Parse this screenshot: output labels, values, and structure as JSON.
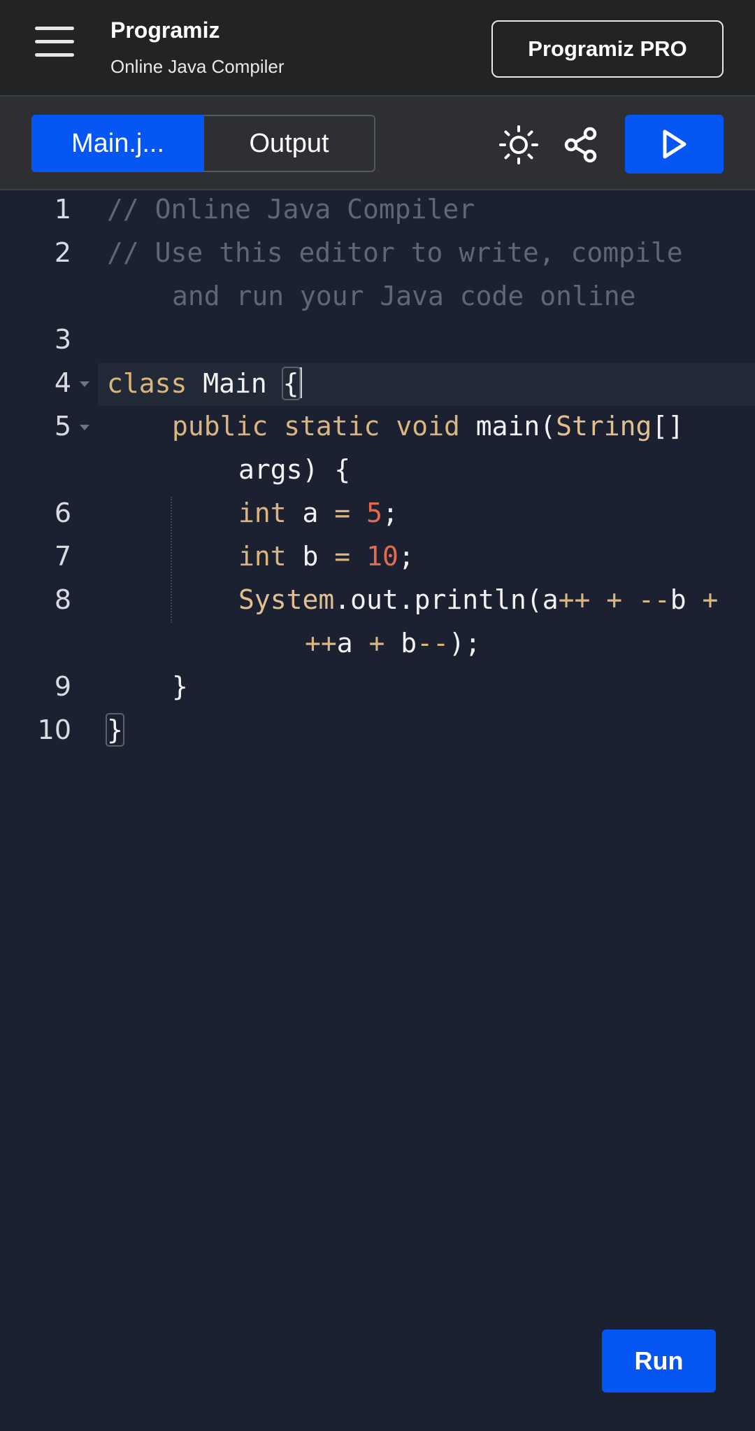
{
  "header": {
    "brand": "rogramiz",
    "brand_initial": "P",
    "subtitle": "Online Java Compiler",
    "pro_button": "Programiz PRO"
  },
  "toolbar": {
    "tabs": [
      {
        "label": "Main.j...",
        "active": true
      },
      {
        "label": "Output",
        "active": false
      }
    ],
    "icons": [
      "theme-sun-icon",
      "share-icon",
      "play-icon"
    ]
  },
  "editor": {
    "line_numbers": [
      "1",
      "2",
      "3",
      "4",
      "5",
      "6",
      "7",
      "8",
      "9",
      "10"
    ],
    "lines": {
      "l1": "// Online Java Compiler",
      "l2a": "// Use this editor to write, compile",
      "l2b": "and run your Java code online",
      "l4_kw": "class",
      "l4_name": " Main ",
      "l4_brace": "{",
      "l5_kw1": "public",
      "l5_kw2": "static",
      "l5_kw3": "void",
      "l5_name": " main(",
      "l5_type": "String",
      "l5_rest": "[]",
      "l5b": "args) {",
      "l6_kw": "int",
      "l6_id": " a ",
      "l6_op": "=",
      "l6_num": "5",
      "l6_end": ";",
      "l7_kw": "int",
      "l7_id": " b ",
      "l7_op": "=",
      "l7_num": "10",
      "l7_end": ";",
      "l8_type": "System",
      "l8_call": ".out.println(a",
      "l8_op1": "++ + --",
      "l8_b": "b ",
      "l8_op2": "+",
      "l8b_op1": "++",
      "l8b_a": "a ",
      "l8b_op2": "+",
      "l8b_b": " b",
      "l8b_op3": "--",
      "l8b_end": ");",
      "l9": "}",
      "l10": "}"
    }
  },
  "run_button": "Run",
  "colors": {
    "accent": "#0556f3",
    "header_bg": "#212325",
    "editor_bg": "#1b2130",
    "keyword": "#dbb57e",
    "number": "#e06c50",
    "comment": "#5f6675"
  }
}
